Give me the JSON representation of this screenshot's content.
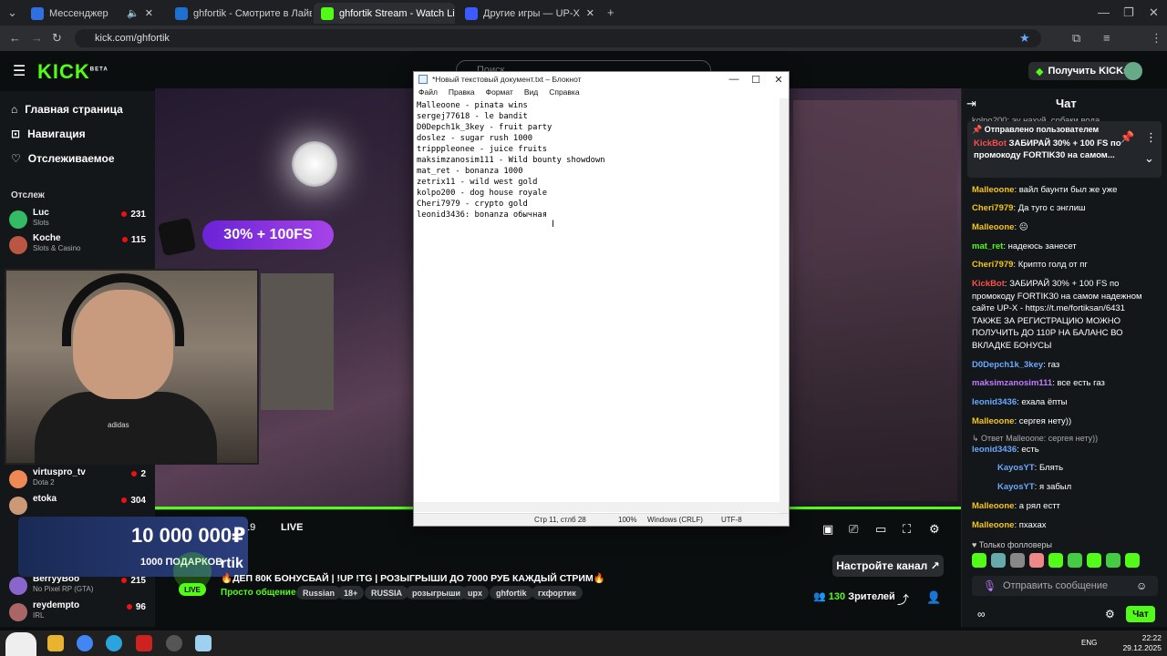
{
  "browser": {
    "tabs": [
      {
        "label": "Мессенджер",
        "color": "#2f6fe0"
      },
      {
        "label": "ghfortik - Смотрите в Лайве н",
        "color": "#1f6fd0"
      },
      {
        "label": "ghfortik Stream - Watch Live o",
        "color": "#53fc18"
      },
      {
        "label": "Другие игры — UP-X",
        "color": "#3b5bff"
      }
    ],
    "url": "kick.com/ghfortik"
  },
  "kick": {
    "logo": "KICK",
    "logo_sup": "BETA",
    "search_placeholder": "Поиск",
    "get_kicks": "Получить KICKs"
  },
  "sidebar": {
    "nav": [
      {
        "label": "Главная страница",
        "icon": "home-icon"
      },
      {
        "label": "Навигация",
        "icon": "compass-icon"
      },
      {
        "label": "Отслеживаемое",
        "icon": "heart-icon"
      }
    ],
    "following_label": "Отслеж",
    "channels": [
      {
        "name": "Luc",
        "game": "Slots",
        "viewers": "231",
        "color": "#3b6"
      },
      {
        "name": "Koche",
        "game": "Slots & Casino",
        "viewers": "115",
        "color": "#b54"
      },
      {
        "name": "virtuspro_tv",
        "game": "Dota 2",
        "viewers": "2",
        "color": "#e85"
      },
      {
        "name": "etoka",
        "game": "",
        "viewers": "304",
        "color": "#c97"
      },
      {
        "name": "BerryyBoo",
        "game": "No Pixel RP (GTA)",
        "viewers": "215",
        "color": "#86c"
      },
      {
        "name": "reydempto",
        "game": "IRL",
        "viewers": "96",
        "color": "#a66"
      }
    ]
  },
  "stream": {
    "promo": "30% + 100FS",
    "timecode": ":19",
    "live_label": "LIVE",
    "tenk_amount": "10 000 000₽",
    "tenk_sub": "1000 ПОДАРКОВ",
    "live_badge": "LIVE",
    "streamer": "rtik",
    "title": "🔥ДЕП 80К БОНУСБАЙ | !UP !TG | РОЗЫГРЫШИ ДО 7000 РУБ КАЖДЫЙ СТРИМ🔥",
    "category": "Просто общение",
    "tags": [
      "Russian",
      "18+",
      "RUSSIA",
      "розыгрыши",
      "upx",
      "ghfortik",
      "гхфортик"
    ],
    "setup_button": "Настройте канал",
    "viewers_count": "130",
    "viewers_label": "Зрителей"
  },
  "chat": {
    "title": "Чат",
    "pinned_header": "Отправлено пользователем",
    "pinned_user": "KickBot",
    "pinned_text": "ЗАБИРАЙ 30% + 100 FS по промокоду FORTIK30 на самом...",
    "top_partial": "kolpo200: эу нахуй, собаки вода",
    "messages": [
      {
        "user": "Malleoone",
        "text": "вайл баунти был же уже",
        "color": "#f5c518"
      },
      {
        "user": "Cheri7979",
        "text": "Да туго с энглиш",
        "color": "#f5c518"
      },
      {
        "user": "Malleoone",
        "text": "😐",
        "color": "#f5c518"
      },
      {
        "user": "mat_ret",
        "text": "надеюсь занесет",
        "color": "#53fc18"
      },
      {
        "user": "Cheri7979",
        "text": "Крипто голд от пг",
        "color": "#f5c518"
      },
      {
        "user": "KickBot",
        "text": "ЗАБИРАЙ 30% + 100 FS по промокоду FORTIK30 на самом надежном сайте UP-X - https://t.me/fortiksan/6431 ТАКЖЕ ЗА РЕГИСТРАЦИЮ МОЖНО ПОЛУЧИТЬ ДО 110Р НА БАЛАНС ВО ВКЛАДКЕ БОНУСЫ",
        "color": "#ff4d4d"
      },
      {
        "user": "D0Depch1k_3key",
        "text": "газ",
        "color": "#6aa9ff"
      },
      {
        "user": "maksimzanosim111",
        "text": "все есть газ",
        "color": "#c07bff"
      },
      {
        "user": "leonid3436",
        "text": "ехала ёпты",
        "color": "#6aa9ff"
      },
      {
        "user": "Malleoone",
        "text": "сергея нету))",
        "color": "#f5c518"
      },
      {
        "user": "leonid3436",
        "text": "есть",
        "color": "#6aa9ff",
        "reply": "Ответ Malleoone: сергея нету))"
      },
      {
        "user": "KayosYT",
        "text": "Блять",
        "color": "#6aa9ff"
      },
      {
        "user": "KayosYT",
        "text": "я забыл",
        "color": "#6aa9ff"
      },
      {
        "user": "Malleoone",
        "text": "а рял естт",
        "color": "#f5c518"
      },
      {
        "user": "Malleoone",
        "text": "пхахах",
        "color": "#f5c518"
      }
    ],
    "followers_only": "Только фолловеры",
    "input_placeholder": "Отправить сообщение",
    "send_label": "Чат"
  },
  "notepad": {
    "title": "*Новый текстовый документ.txt – Блокнот",
    "menu": [
      "Файл",
      "Правка",
      "Формат",
      "Вид",
      "Справка"
    ],
    "text": "Malleoone - pinata wins\nsergej77618 - le bandit\nD0Depch1k_3key - fruit party\ndoslez - sugar rush 1000\ntripppleonee - juice fruits\nmaksimzanosim111 - Wild bounty showdown\nmat_ret - bonanza 1000\nzetrix11 - wild west gold\nkolpo200 - dog house royale\nCheri7979 - crypto gold\nleonid3436: bonanza обычная",
    "status_pos": "Стр 11, стлб 28",
    "status_zoom": "100%",
    "status_eol": "Windows (CRLF)",
    "status_enc": "UTF-8"
  },
  "taskbar": {
    "lang": "ENG",
    "time": "22:22",
    "date": "29.12.2025"
  }
}
